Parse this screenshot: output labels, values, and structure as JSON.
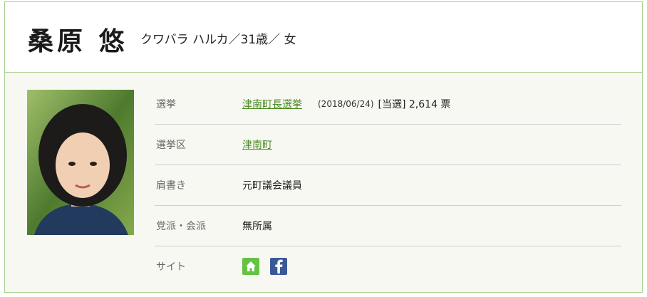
{
  "profile": {
    "name": "桑原 悠",
    "meta": "クワバラ ハルカ／31歳／ 女"
  },
  "details": {
    "election": {
      "label": "選挙",
      "link": "津南町長選挙",
      "date": "(2018/06/24)",
      "result": "[当選] 2,614 票"
    },
    "district": {
      "label": "選挙区",
      "link": "津南町"
    },
    "title": {
      "label": "肩書き",
      "value": "元町議会議員"
    },
    "party": {
      "label": "党派・会派",
      "value": "無所属"
    },
    "site": {
      "label": "サイト",
      "icons": [
        "home-icon",
        "facebook-icon"
      ]
    }
  },
  "colors": {
    "accent_green": "#65c243",
    "link_green": "#4a8a22",
    "border_green": "#a9cf8f",
    "facebook_blue": "#3b5998"
  }
}
